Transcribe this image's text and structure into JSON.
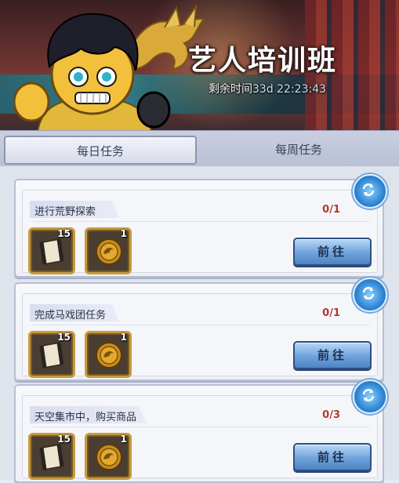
{
  "header": {
    "title": "艺人培训班",
    "remaining_label": "剩余时间",
    "remaining_value": "33d 22:23:43"
  },
  "tabs": [
    {
      "label": "每日任务",
      "selected": true
    },
    {
      "label": "每周任务",
      "selected": false
    }
  ],
  "tasks": [
    {
      "text": "进行荒野探索",
      "progress": "0/1",
      "rewards": [
        {
          "icon": "film-scroll-icon",
          "count": "15"
        },
        {
          "icon": "dragon-coin-icon",
          "count": "1"
        }
      ],
      "button": "前往"
    },
    {
      "text": "完成马戏团任务",
      "progress": "0/1",
      "rewards": [
        {
          "icon": "film-scroll-icon",
          "count": "15"
        },
        {
          "icon": "dragon-coin-icon",
          "count": "1"
        }
      ],
      "button": "前往"
    },
    {
      "text": "天空集市中，购买商品",
      "progress": "0/3",
      "rewards": [
        {
          "icon": "film-scroll-icon",
          "count": "15"
        },
        {
          "icon": "dragon-coin-icon",
          "count": "1"
        }
      ],
      "button": "前往"
    }
  ],
  "colors": {
    "progress": "#b23a2c",
    "accent": "#6ea3dd",
    "frame_gold": "#c79a3c"
  }
}
